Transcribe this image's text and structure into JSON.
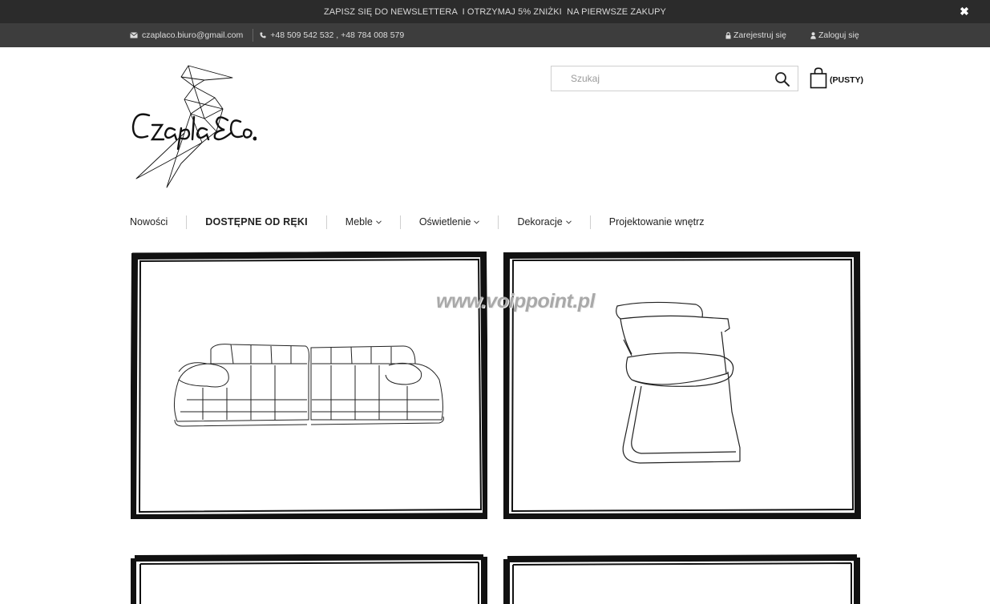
{
  "promo": {
    "text": "ZAPISZ SIĘ DO NEWSLETTERA  I OTRZYMAJ 5% ZNIŻKI  NA PIERWSZE ZAKUPY",
    "close_icon": "close-icon"
  },
  "contact": {
    "email": "czaplaco.biuro@gmail.com",
    "phone": "+48 509 542 532 , +48 784 008 579",
    "register_label": "Zarejestruj się",
    "login_label": "Zaloguj się"
  },
  "search": {
    "placeholder": "Szukaj",
    "value": ""
  },
  "cart": {
    "label": "(PUSTY)"
  },
  "nav": {
    "items": [
      {
        "label": "Nowości"
      },
      {
        "label": "DOSTĘPNE OD RĘKI"
      },
      {
        "label": "Meble"
      },
      {
        "label": "Oświetlenie"
      },
      {
        "label": "Dekoracje"
      },
      {
        "label": "Projektowanie wnętrz"
      }
    ],
    "chevron": "⌄"
  },
  "watermark": "www.voippoint.pl",
  "colors": {
    "promo_bg": "#2b2b2b",
    "contact_bg": "#3d3d3d",
    "frame": "#111111"
  }
}
